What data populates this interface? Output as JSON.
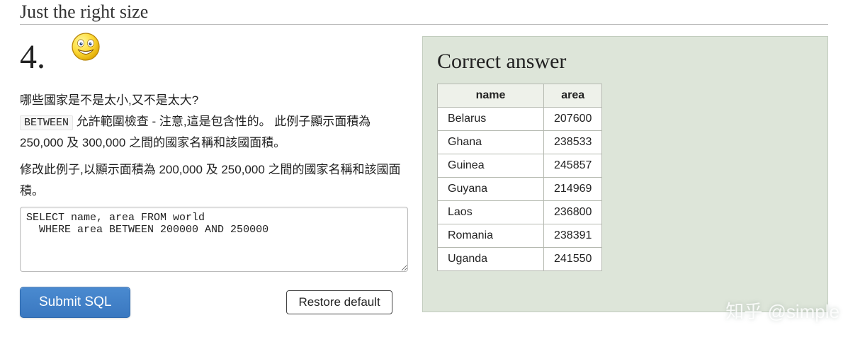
{
  "section_title": "Just the right size",
  "question": {
    "number": "4.",
    "icon": "smiley-big-grin-icon",
    "para1_pre": "哪些國家是不是太小,又不是太大?",
    "para1_keyword": "BETWEEN",
    "para1_post": " 允許範圍檢查 - 注意,這是包含性的。 此例子顯示面積為 250,000 及 300,000 之間的國家名稱和該國面積。",
    "para2": "修改此例子,以顯示面積為 200,000 及 250,000 之間的國家名稱和該國面積。"
  },
  "sql_input": "SELECT name, area FROM world\n  WHERE area BETWEEN 200000 AND 250000",
  "buttons": {
    "submit": "Submit SQL",
    "restore": "Restore default"
  },
  "answer": {
    "title": "Correct answer",
    "columns": [
      "name",
      "area"
    ],
    "rows": [
      {
        "name": "Belarus",
        "area": "207600"
      },
      {
        "name": "Ghana",
        "area": "238533"
      },
      {
        "name": "Guinea",
        "area": "245857"
      },
      {
        "name": "Guyana",
        "area": "214969"
      },
      {
        "name": "Laos",
        "area": "236800"
      },
      {
        "name": "Romania",
        "area": "238391"
      },
      {
        "name": "Uganda",
        "area": "241550"
      }
    ]
  },
  "watermark": "知乎 @simple"
}
